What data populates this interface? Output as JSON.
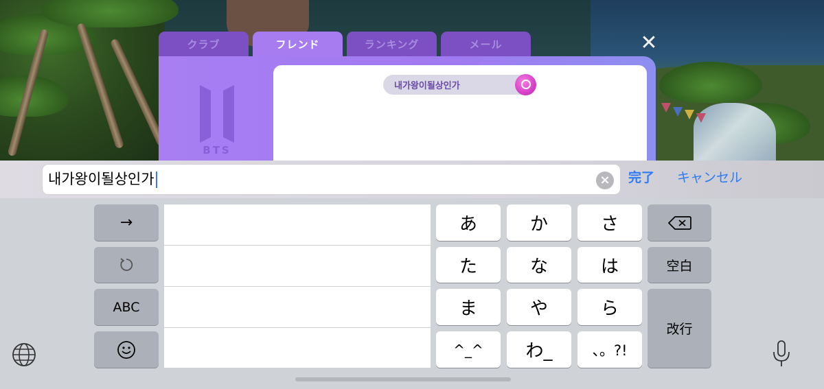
{
  "game": {
    "tabs": [
      {
        "label": "クラブ",
        "active": false
      },
      {
        "label": "フレンド",
        "active": true
      },
      {
        "label": "ランキング",
        "active": false
      },
      {
        "label": "メール",
        "active": false
      }
    ],
    "close_icon": "close-icon",
    "logo_text": "BTS",
    "search_query": "내가왕이될상인가",
    "search_icon": "search-icon",
    "colors": {
      "tab_active": "#a67cf0",
      "tab_inactive": "#7c4fc2",
      "panel": "#a87ef2",
      "search_button": "#d640c8"
    }
  },
  "input_bar": {
    "value": "내가왕이될상인가",
    "clear_icon": "clear-icon",
    "done_label": "完了",
    "cancel_label": "キャンセル",
    "accent": "#2f7bf5"
  },
  "keyboard": {
    "left_keys": {
      "arrow": "→",
      "undo_icon": "undo-icon",
      "abc": "ABC",
      "emoji_icon": "emoji-icon"
    },
    "kana_rows": [
      [
        "あ",
        "か",
        "さ"
      ],
      [
        "た",
        "な",
        "は"
      ],
      [
        "ま",
        "や",
        "ら"
      ],
      [
        "^_^",
        "わ_",
        "、。?!"
      ]
    ],
    "right_keys": {
      "delete_icon": "delete-icon",
      "space": "空白",
      "return": "改行"
    },
    "globe_icon": "globe-icon",
    "mic_icon": "microphone-icon"
  }
}
